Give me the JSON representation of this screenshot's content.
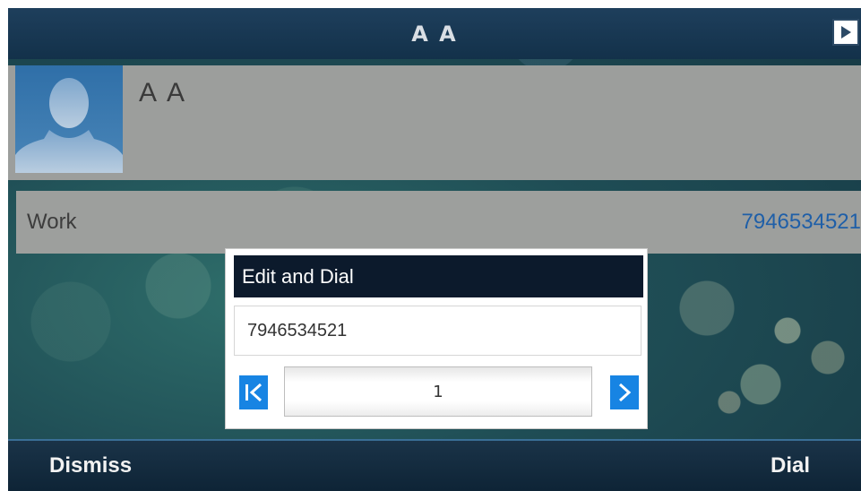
{
  "header": {
    "title": "A A",
    "nav_icon": "play-arrow-icon"
  },
  "contact": {
    "name": "A A",
    "avatar_icon": "person-silhouette-icon"
  },
  "number_entry": {
    "label": "Work",
    "value": "7946534521"
  },
  "dialog": {
    "title": "Edit and Dial",
    "number_value": "7946534521",
    "page": "1",
    "first_icon": "first-page-icon",
    "next_icon": "next-page-icon",
    "accent_color": "#1784e3"
  },
  "softkeys": {
    "left": "Dismiss",
    "right": "Dial"
  }
}
